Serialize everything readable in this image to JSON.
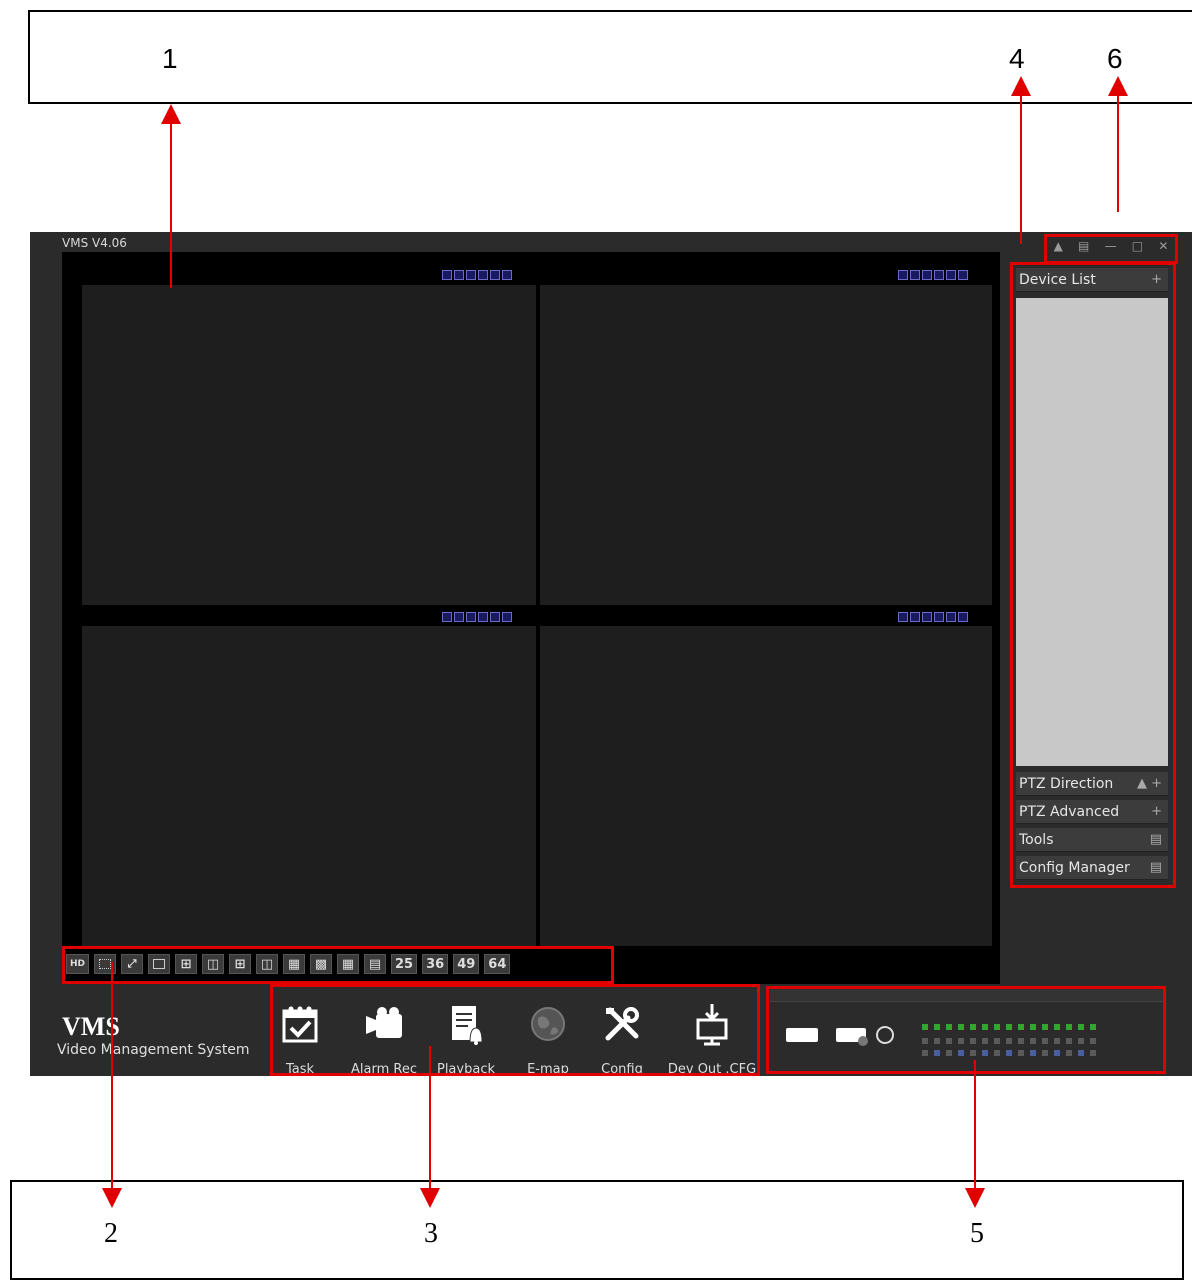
{
  "callouts": {
    "n1": "1",
    "n2": "2",
    "n3": "3",
    "n4": "4",
    "n5": "5",
    "n6": "6"
  },
  "app": {
    "title": "VMS  V4.06",
    "window_controls": [
      "lock-icon",
      "menu-icon",
      "minimize-icon",
      "maximize-icon",
      "close-icon"
    ],
    "video_cells": 4,
    "cell_toolbar_icons": [
      "layout-icon",
      "grid-icon",
      "record-icon",
      "snapshot-icon",
      "audio-icon",
      "close-icon"
    ]
  },
  "layout_bar": {
    "buttons": [
      "HD",
      "",
      "",
      "",
      "",
      "",
      "",
      "",
      "",
      "",
      "",
      "",
      "25",
      "36",
      "49",
      "64"
    ]
  },
  "right_panel": {
    "device_list": "Device List",
    "ptz_direction": "PTZ Direction",
    "ptz_advanced": "PTZ Advanced",
    "tools": "Tools",
    "config_manager": "Config Manager",
    "plus": "+"
  },
  "logo": {
    "title": "VMS",
    "subtitle": "Video Management System"
  },
  "functions": [
    {
      "label": "Task",
      "icon": "calendar-check-icon"
    },
    {
      "label": "Alarm Rec",
      "icon": "camera-icon"
    },
    {
      "label": "Playback",
      "icon": "notepad-bell-icon"
    },
    {
      "label": "E-map",
      "icon": "globe-icon"
    },
    {
      "label": "Config",
      "icon": "tools-icon"
    },
    {
      "label": "Dev Out .CFG",
      "icon": "monitor-download-icon"
    }
  ],
  "colors": {
    "highlight": "#e00000",
    "arrow": "#e00000",
    "status_green": "#2fa82f",
    "status_gray": "#5a5a5a",
    "status_blue": "#4a5fa0"
  }
}
